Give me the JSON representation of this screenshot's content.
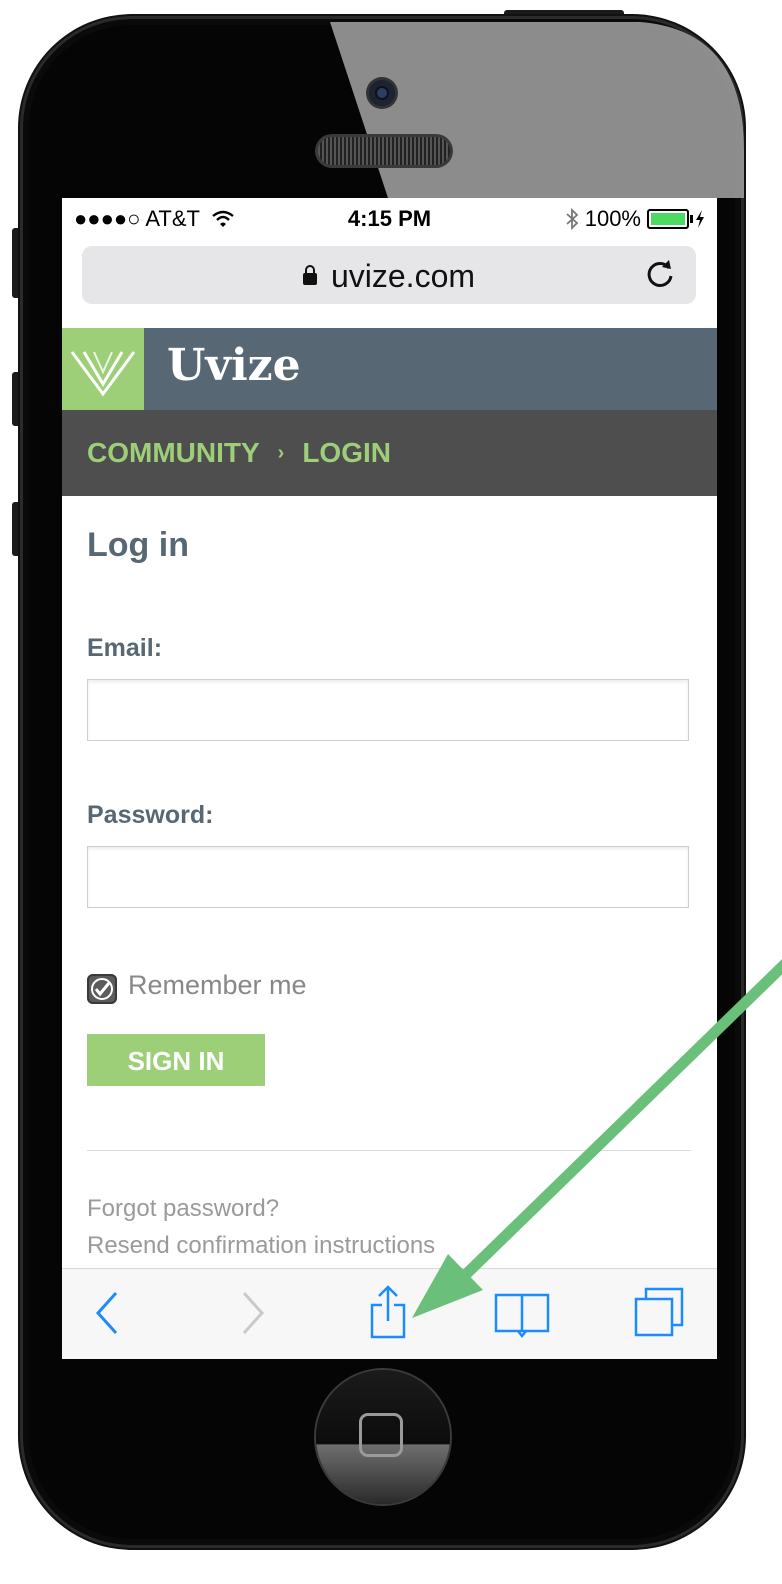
{
  "status_bar": {
    "carrier": "●●●●○ AT&T",
    "time": "4:15 PM",
    "battery": "100%",
    "battery_color": "#4cd964"
  },
  "url_bar": {
    "url": "uvize.com",
    "lock_icon": "lock-icon",
    "reload_icon": "reload-icon"
  },
  "site": {
    "brand": "Uvize",
    "brand_color": "#9ccf78",
    "header_color": "#576874"
  },
  "breadcrumb": {
    "items": [
      "COMMUNITY",
      "LOGIN"
    ],
    "separator": "›"
  },
  "form": {
    "title": "Log in",
    "email_label": "Email:",
    "email_value": "",
    "password_label": "Password:",
    "password_value": "",
    "remember_label": "Remember me",
    "remember_checked": true,
    "submit_label": "SIGN IN"
  },
  "links": {
    "forgot": "Forgot password?",
    "resend": "Resend confirmation instructions"
  },
  "toolbar": {
    "icons": [
      "back-icon",
      "forward-icon",
      "share-icon",
      "bookmarks-icon",
      "tabs-icon"
    ],
    "accent_color": "#1a8cff"
  },
  "annotation": {
    "arrow_color": "#6abf7b",
    "target": "share-icon"
  }
}
